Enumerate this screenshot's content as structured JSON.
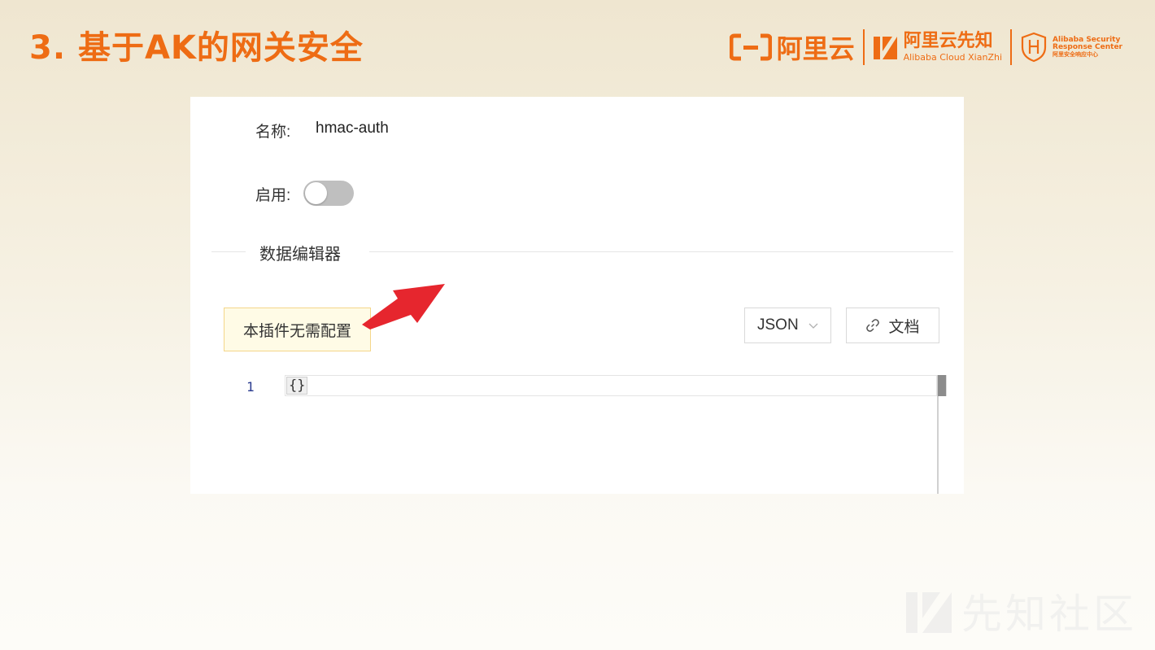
{
  "slide": {
    "title": "3. 基于AK的网关安全"
  },
  "logos": {
    "aliyun": "阿里云",
    "xianzhi_cn": "阿里云先知",
    "xianzhi_en": "Alibaba Cloud XianZhi",
    "asrc_line1": "Alibaba Security",
    "asrc_line2": "Response Center",
    "asrc_line3": "阿里安全响应中心"
  },
  "form": {
    "name_label": "名称:",
    "name_value": "hmac-auth",
    "enable_label": "启用:",
    "enabled": false,
    "section_title": "数据编辑器"
  },
  "editor": {
    "tip": "本插件无需配置",
    "format_select": "JSON",
    "doc_button": "文档",
    "line_number": "1",
    "code": "{}"
  },
  "watermark": {
    "text": "先知社区"
  },
  "colors": {
    "accent": "#ee6c14",
    "arrow": "#e6262e",
    "tip_bg": "#fffbe6",
    "tip_border": "#f4d68a"
  }
}
